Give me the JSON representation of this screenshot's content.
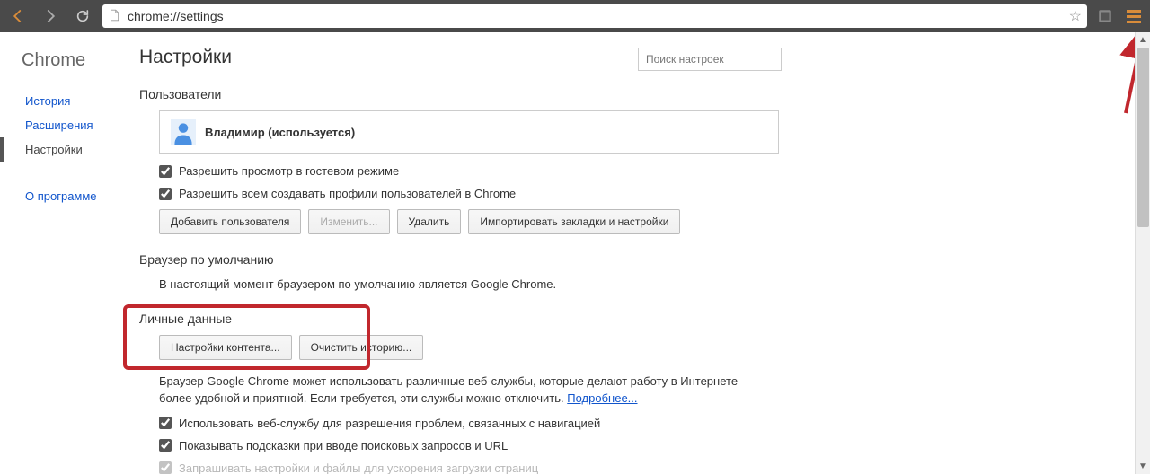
{
  "chrome_bar": {
    "url": "chrome://settings"
  },
  "sidebar": {
    "brand": "Chrome",
    "items": [
      {
        "label": "История",
        "active": false
      },
      {
        "label": "Расширения",
        "active": false
      },
      {
        "label": "Настройки",
        "active": true
      }
    ],
    "about": "О программе"
  },
  "header": {
    "title": "Настройки",
    "search_placeholder": "Поиск настроек"
  },
  "users": {
    "title": "Пользователи",
    "profile_name": "Владимир (используется)",
    "guest_label": "Разрешить просмотр в гостевом режиме",
    "allow_create_label": "Разрешить всем создавать профили пользователей в Chrome",
    "buttons": {
      "add": "Добавить пользователя",
      "edit": "Изменить...",
      "delete": "Удалить",
      "import": "Импортировать закладки и настройки"
    }
  },
  "default_browser": {
    "title": "Браузер по умолчанию",
    "desc": "В настоящий момент браузером по умолчанию является Google Chrome."
  },
  "privacy": {
    "title": "Личные данные",
    "buttons": {
      "content": "Настройки контента...",
      "clear": "Очистить историю..."
    },
    "desc_line1": "Браузер Google Chrome может использовать различные веб-службы, которые делают работу в Интернете",
    "desc_line2": "более удобной и приятной. Если требуется, эти службы можно отключить. ",
    "learn_more": "Подробнее...",
    "check1": "Использовать веб-службу для разрешения проблем, связанных с навигацией",
    "check2": "Показывать подсказки при вводе поисковых запросов и URL",
    "check3": "Запрашивать настройки и файлы для ускорения загрузки страниц"
  }
}
